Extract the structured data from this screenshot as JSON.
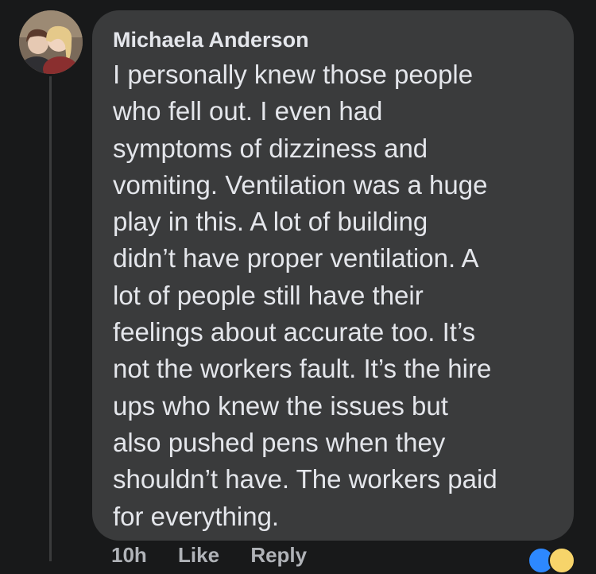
{
  "comment": {
    "author": "Michaela Anderson",
    "lines": [
      "I personally knew those people",
      "who fell out. I even had",
      "symptoms of dizziness and",
      "vomiting. Ventilation was a huge",
      "play in this. A lot of building",
      "didn’t have proper ventilation. A",
      "lot of people still have their",
      "feelings about accurate too. It’s",
      "not the workers fault. It’s the hire",
      "ups who knew the issues but",
      "also pushed pens when they",
      "shouldn’t have. The workers paid",
      "for everything."
    ],
    "avatar_icon": "profile-photo"
  },
  "footer": {
    "time": "10h",
    "like_label": "Like",
    "reply_label": "Reply"
  },
  "reactions": {
    "icons": [
      "like-reaction-icon",
      "haha-reaction-icon"
    ]
  },
  "colors": {
    "background": "#18191a",
    "bubble": "#3a3b3c",
    "text": "#e4e6eb",
    "like_blue": "#2d88ff",
    "haha_yellow": "#f7d46a"
  }
}
